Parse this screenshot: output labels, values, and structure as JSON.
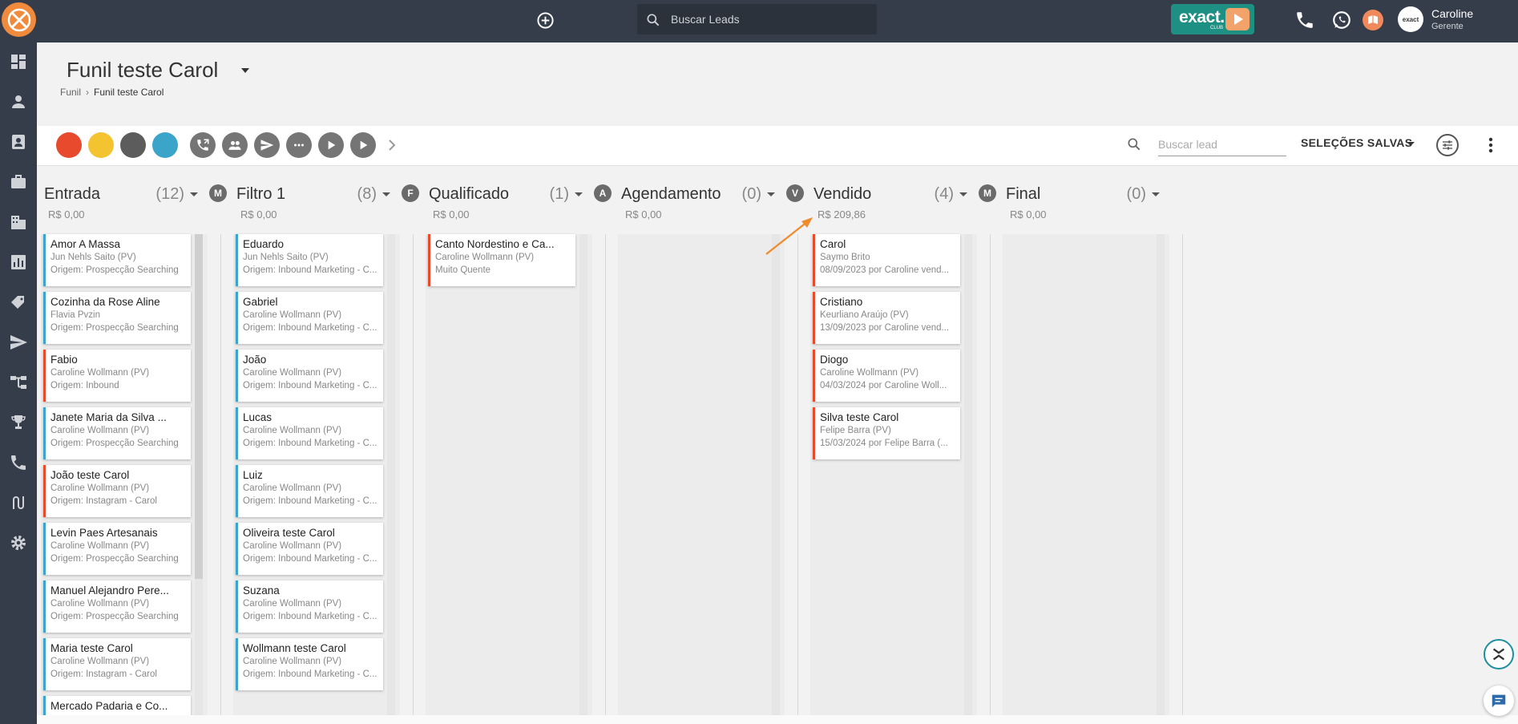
{
  "topbar": {
    "search_placeholder": "Buscar Leads",
    "brand_badge": "exact.",
    "brand_badge_sub": "CLUB",
    "user_name": "Caroline",
    "user_role": "Gerente",
    "avatar_text": "exact"
  },
  "header": {
    "title": "Funil teste Carol",
    "breadcrumb": [
      "Funil",
      "Funil teste Carol"
    ]
  },
  "toolbar": {
    "color_filters": [
      "#e84a2d",
      "#f4c430",
      "#5c5c5c",
      "#3aa5c9"
    ],
    "actions": [
      "phone-transfer-icon",
      "group-icon",
      "send-icon",
      "more-horiz-icon",
      "play-icon",
      "play-icon"
    ],
    "lead_search_placeholder": "Buscar lead",
    "saved_selections": "SELEÇÕES SALVAS"
  },
  "columns": [
    {
      "badge": "",
      "title": "Entrada",
      "count": "(12)",
      "value": "R$ 0,00",
      "cards": [
        {
          "name": "Amor A Massa",
          "owner": "Jun Nehls Saito (PV)",
          "detail": "Origem: Prospecção Searching",
          "color": "blue"
        },
        {
          "name": "Cozinha da Rose Aline",
          "owner": "Flavia Pvzin",
          "detail": "Origem: Prospecção Searching",
          "color": "blue"
        },
        {
          "name": "Fabio",
          "owner": "Caroline Wollmann (PV)",
          "detail": "Origem: Inbound",
          "color": "red"
        },
        {
          "name": "Janete Maria da Silva ...",
          "owner": "Caroline Wollmann (PV)",
          "detail": "Origem: Prospecção Searching",
          "color": "blue"
        },
        {
          "name": "João teste Carol",
          "owner": "Caroline Wollmann (PV)",
          "detail": "Origem: Instagram - Carol",
          "color": "red"
        },
        {
          "name": "Levin Paes Artesanais",
          "owner": "Caroline Wollmann (PV)",
          "detail": "Origem: Prospecção Searching",
          "color": "blue"
        },
        {
          "name": "Manuel Alejandro Pere...",
          "owner": "Caroline Wollmann (PV)",
          "detail": "Origem: Prospecção Searching",
          "color": "blue"
        },
        {
          "name": "Maria teste Carol",
          "owner": "Caroline Wollmann (PV)",
          "detail": "Origem: Instagram - Carol",
          "color": "blue"
        },
        {
          "name": "Mercado Padaria e Co...",
          "owner": "",
          "detail": "",
          "color": "blue"
        }
      ]
    },
    {
      "badge": "M",
      "title": "Filtro 1",
      "count": "(8)",
      "value": "R$ 0,00",
      "cards": [
        {
          "name": "Eduardo",
          "owner": "Jun Nehls Saito (PV)",
          "detail": "Origem: Inbound Marketing - C...",
          "color": "blue"
        },
        {
          "name": "Gabriel",
          "owner": "Caroline Wollmann (PV)",
          "detail": "Origem: Inbound Marketing - C...",
          "color": "blue"
        },
        {
          "name": "João",
          "owner": "Caroline Wollmann (PV)",
          "detail": "Origem: Inbound Marketing - C...",
          "color": "blue"
        },
        {
          "name": "Lucas",
          "owner": "Caroline Wollmann (PV)",
          "detail": "Origem: Inbound Marketing - C...",
          "color": "blue"
        },
        {
          "name": "Luiz",
          "owner": "Caroline Wollmann (PV)",
          "detail": "Origem: Inbound Marketing - C...",
          "color": "blue"
        },
        {
          "name": "Oliveira teste Carol",
          "owner": "Caroline Wollmann (PV)",
          "detail": "Origem: Inbound Marketing - C...",
          "color": "blue"
        },
        {
          "name": "Suzana",
          "owner": "Caroline Wollmann (PV)",
          "detail": "Origem: Inbound Marketing - C...",
          "color": "blue"
        },
        {
          "name": "Wollmann teste Carol",
          "owner": "Caroline Wollmann (PV)",
          "detail": "Origem: Inbound Marketing - C...",
          "color": "blue"
        }
      ]
    },
    {
      "badge": "F",
      "title": "Qualificado",
      "count": "(1)",
      "value": "R$ 0,00",
      "cards": [
        {
          "name": "Canto Nordestino e Ca...",
          "owner": "Caroline Wollmann (PV)",
          "detail": "Muito Quente",
          "color": "red"
        }
      ]
    },
    {
      "badge": "A",
      "title": "Agendamento",
      "count": "(0)",
      "value": "R$ 0,00",
      "cards": []
    },
    {
      "badge": "V",
      "title": "Vendido",
      "count": "(4)",
      "value": "R$ 209,86",
      "cards": [
        {
          "name": "Carol",
          "owner": "Saymo Brito",
          "detail": "08/09/2023 por Caroline vend...",
          "color": "red"
        },
        {
          "name": "Cristiano",
          "owner": "Keurliano Araújo (PV)",
          "detail": "13/09/2023 por Caroline vend...",
          "color": "red"
        },
        {
          "name": "Diogo",
          "owner": "Caroline Wollmann (PV)",
          "detail": "04/03/2024 por Caroline Woll...",
          "color": "red"
        },
        {
          "name": "Silva teste Carol",
          "owner": "Felipe Barra (PV)",
          "detail": "15/03/2024 por Felipe Barra (...",
          "color": "red"
        }
      ]
    },
    {
      "badge": "M",
      "title": "Final",
      "count": "(0)",
      "value": "R$ 0,00",
      "cards": []
    }
  ]
}
